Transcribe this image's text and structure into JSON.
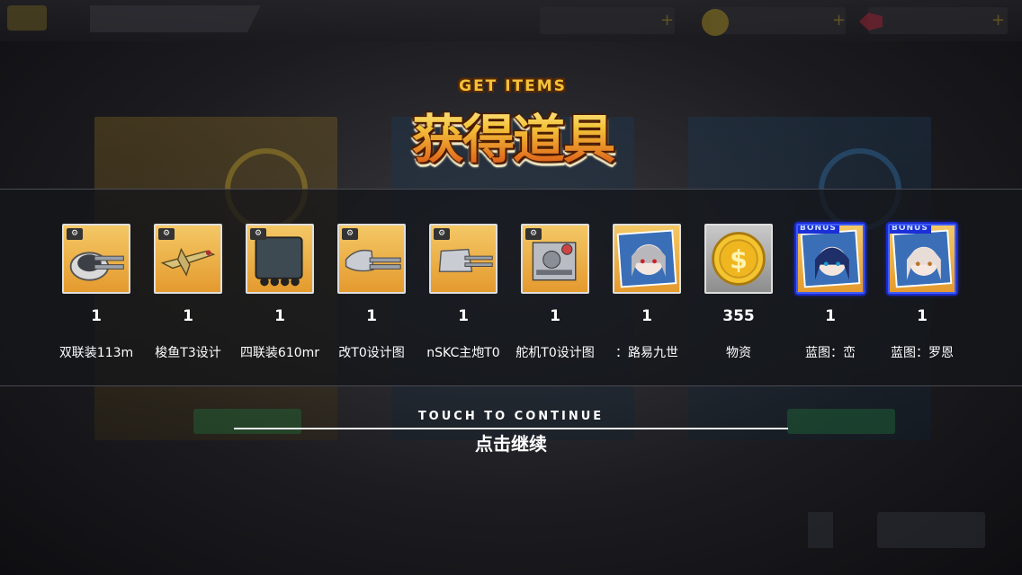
{
  "header": {
    "title_en": "GET ITEMS",
    "title_cn": "获得道具"
  },
  "items": [
    {
      "name": "双联装113m",
      "count": "1",
      "icon": "twin-turret-icon",
      "frame": "gold",
      "bonus": false
    },
    {
      "name": "梭鱼T3设计",
      "count": "1",
      "icon": "plane-icon",
      "frame": "gold",
      "bonus": false
    },
    {
      "name": "四联装610mr",
      "count": "1",
      "icon": "torpedo-launcher-icon",
      "frame": "gold",
      "bonus": false
    },
    {
      "name": "改T0设计图",
      "count": "1",
      "icon": "gun-turret-icon",
      "frame": "gold",
      "bonus": false
    },
    {
      "name": "nSKC主炮T0",
      "count": "1",
      "icon": "main-gun-icon",
      "frame": "gold",
      "bonus": false
    },
    {
      "name": "舵机T0设计图",
      "count": "1",
      "icon": "machinery-icon",
      "frame": "gold",
      "bonus": false
    },
    {
      "name": "：路易九世",
      "count": "1",
      "icon": "blueprint-character-icon",
      "frame": "gold",
      "bonus": false
    },
    {
      "name": "物资",
      "count": "355",
      "icon": "coin-icon",
      "frame": "gray",
      "bonus": false
    },
    {
      "name": "蓝图：峦",
      "count": "1",
      "icon": "blueprint-character-icon",
      "frame": "blue",
      "bonus": true,
      "bonus_label": "BONUS"
    },
    {
      "name": "蓝图：罗恩",
      "count": "1",
      "icon": "blueprint-character-icon",
      "frame": "blue",
      "bonus": true,
      "bonus_label": "BONUS"
    }
  ],
  "continue": {
    "label_en": "TOUCH TO CONTINUE",
    "label_cn": "点击继续"
  },
  "colors": {
    "gold_frame": "#e9a93a",
    "bonus_border": "#3d5cff",
    "title": "#f3c23a"
  }
}
